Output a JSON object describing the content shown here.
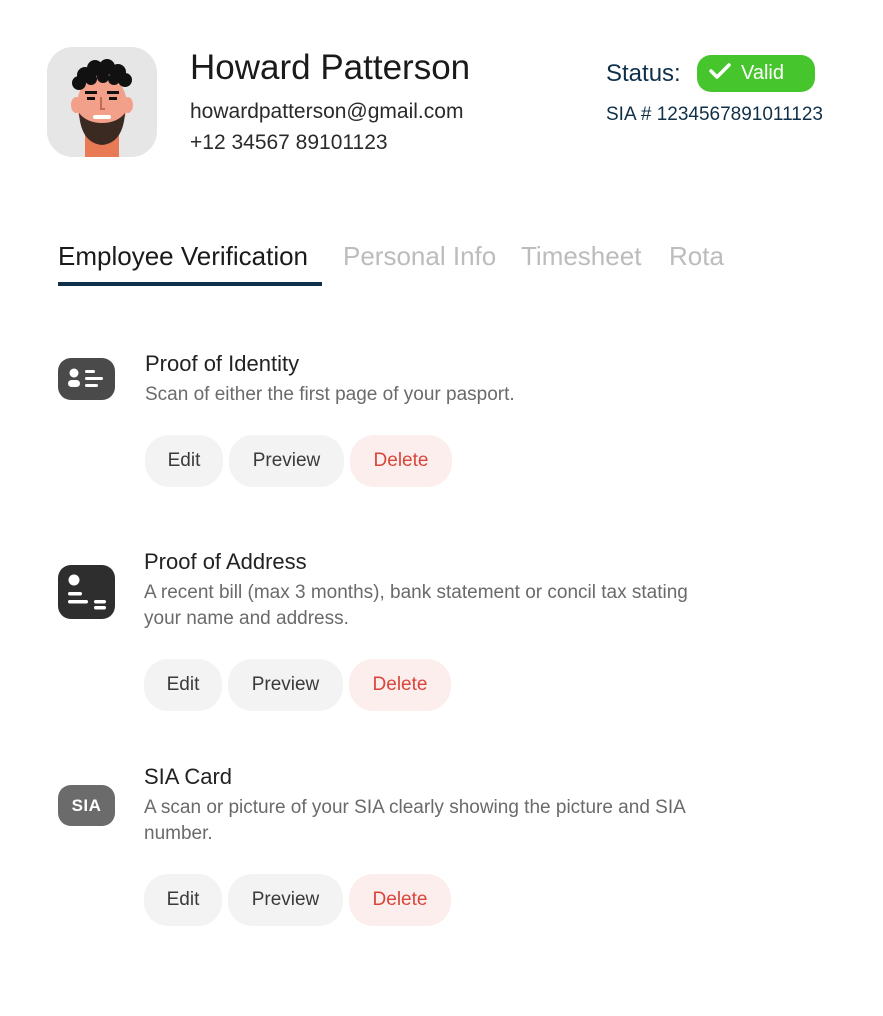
{
  "profile": {
    "name": "Howard Patterson",
    "email": "howardpatterson@gmail.com",
    "phone": "+12 34567 89101123",
    "status_label": "Status:",
    "status_value": "Valid",
    "sia_number": "SIA # 1234567891011123",
    "colors": {
      "accent": "#10304a",
      "valid": "#47c52d"
    }
  },
  "tabs": [
    {
      "label": "Employee Verification",
      "active": true
    },
    {
      "label": "Personal Info",
      "active": false
    },
    {
      "label": "Timesheet",
      "active": false
    },
    {
      "label": "Rota",
      "active": false
    }
  ],
  "documents": [
    {
      "icon": "id-card-icon",
      "title": "Proof of Identity",
      "description": "Scan of either the first page of your pasport.",
      "actions": {
        "edit": "Edit",
        "preview": "Preview",
        "delete": "Delete"
      }
    },
    {
      "icon": "address-card-icon",
      "title": "Proof of Address",
      "description": "A recent bill (max 3 months), bank statement or concil tax stating your name and address.",
      "actions": {
        "edit": "Edit",
        "preview": "Preview",
        "delete": "Delete"
      }
    },
    {
      "icon": "sia-card-icon",
      "icon_text": "SIA",
      "title": "SIA Card",
      "description": "A scan or picture of your SIA clearly showing the picture and SIA number.",
      "actions": {
        "edit": "Edit",
        "preview": "Preview",
        "delete": "Delete"
      }
    }
  ]
}
